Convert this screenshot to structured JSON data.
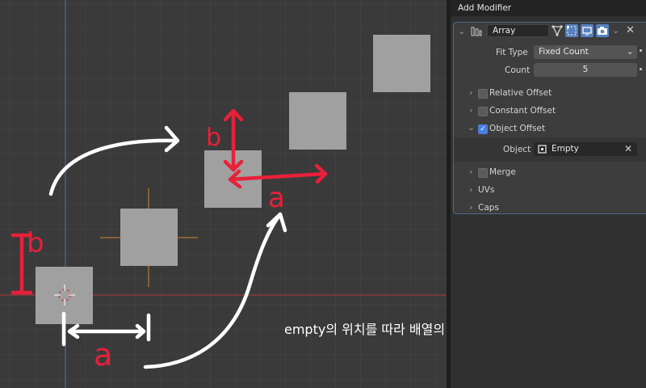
{
  "header": {
    "title": "Add Modifier"
  },
  "modifier": {
    "name": "Array",
    "fit_type_label": "Fit Type",
    "fit_type_value": "Fixed Count",
    "count_label": "Count",
    "count_value": "5",
    "relative_offset": {
      "label": "Relative Offset",
      "checked": false
    },
    "constant_offset": {
      "label": "Constant Offset",
      "checked": false
    },
    "object_offset": {
      "label": "Object Offset",
      "checked": true
    },
    "object_label": "Object",
    "object_value": "Empty",
    "merge": {
      "label": "Merge",
      "checked": false
    },
    "uvs_label": "UVs",
    "caps_label": "Caps"
  },
  "annotations": {
    "label_a_bottom": "a",
    "label_b_left": "b",
    "label_a_mid": "a",
    "label_b_mid": "b",
    "caption": "empty의 위치를 따라 배열의 모양이 변한다."
  },
  "colors": {
    "accent_blue": "#4a7ee0",
    "annotation_red": "#e8203a",
    "cube_gray": "#a0a0a0",
    "viewport_bg": "#3a3a3a"
  }
}
